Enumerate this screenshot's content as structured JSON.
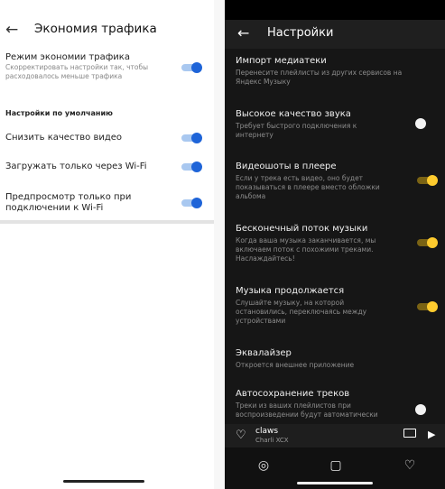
{
  "left": {
    "title": "Экономия трафика",
    "rows": [
      {
        "label": "Режим экономии трафика",
        "sub": "Скорректировать настройки так, чтобы расходовалось меньше трафика",
        "on": true
      },
      {
        "label": "Снизить качество видео",
        "on": true
      },
      {
        "label": "Загружать только через Wi-Fi",
        "on": true
      },
      {
        "label": "Предпросмотр только при подключении к Wi-Fi",
        "on": true
      }
    ],
    "section": "Настройки по умолчанию"
  },
  "right": {
    "title": "Настройки",
    "rows": [
      {
        "label": "Импорт медиатеки",
        "sub": "Перенесите плейлисты из других сервисов на Яндекс Музыку"
      },
      {
        "label": "Высокое качество звука",
        "sub": "Требует быстрого подключения к интернету",
        "on": false
      },
      {
        "label": "Видеошоты в плеере",
        "sub": "Если у трека есть видео, оно будет показываться в плеере вместо обложки альбома",
        "on": true
      },
      {
        "label": "Бесконечный поток музыки",
        "sub": "Когда ваша музыка заканчивается, мы включаем поток с похожими треками. Наслаждайтесь!",
        "on": true
      },
      {
        "label": "Музыка продолжается",
        "sub": "Слушайте музыку, на которой остановились, переключаясь между устройствами",
        "on": true
      },
      {
        "label": "Эквалайзер",
        "sub": "Откроется внешнее приложение"
      },
      {
        "label": "Автосохранение треков",
        "sub": "Треки из ваших плейлистов при воспроизведении будут автоматически",
        "on": false
      }
    ],
    "player": {
      "track": "claws",
      "artist": "Charli XCX"
    }
  },
  "colors": {
    "left_toggle": "#1e64d8",
    "right_toggle": "#fecb2e"
  }
}
